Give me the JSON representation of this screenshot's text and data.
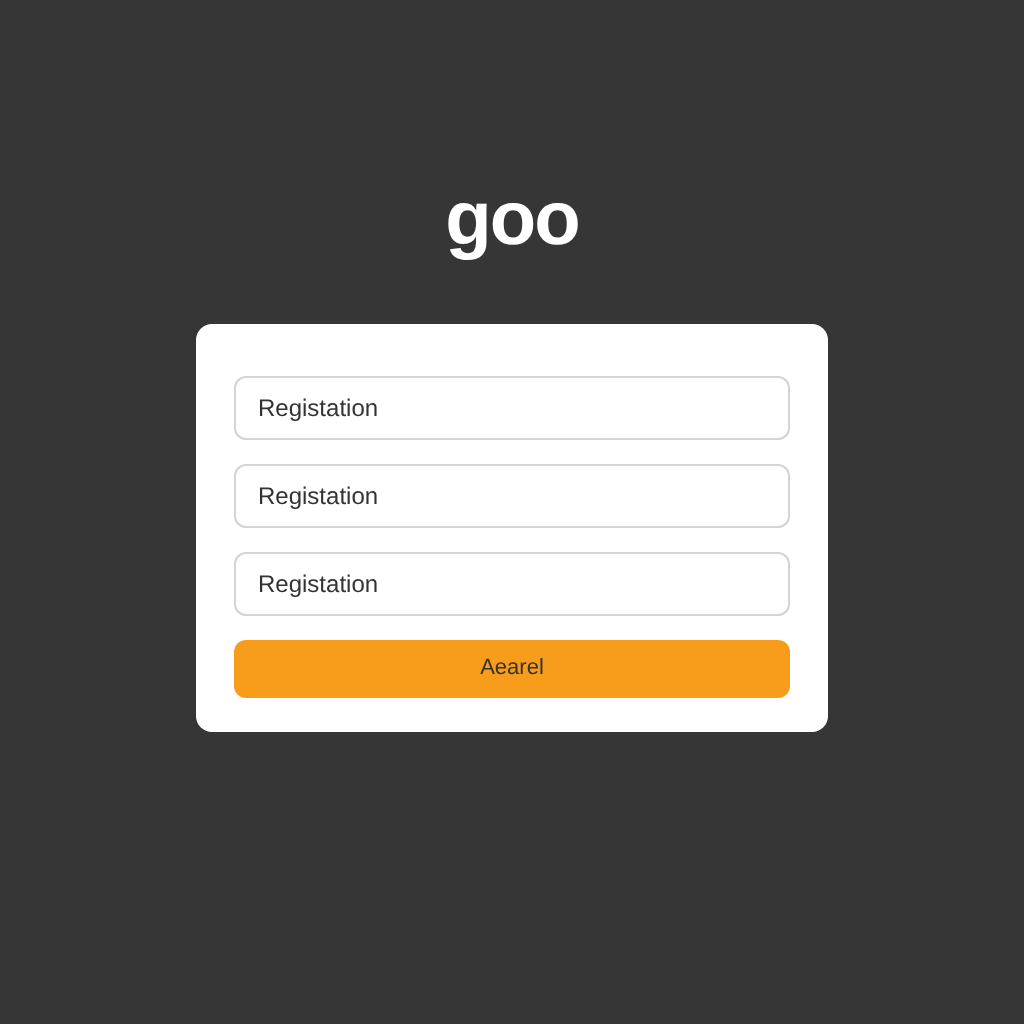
{
  "logo": "goo",
  "fields": [
    {
      "value": "Registation"
    },
    {
      "value": "Registation"
    },
    {
      "value": "Registation"
    }
  ],
  "button": "Aearel"
}
